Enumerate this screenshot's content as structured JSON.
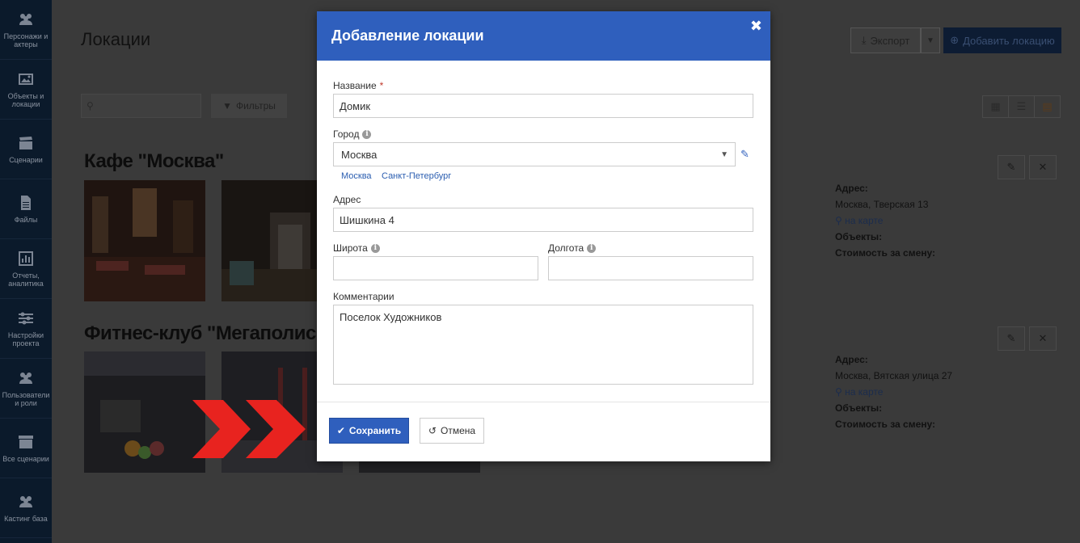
{
  "sidebar": {
    "items": [
      {
        "label": "Персонажи и актеры",
        "icon": "people-icon"
      },
      {
        "label": "Объекты и локации",
        "icon": "image-icon"
      },
      {
        "label": "Сценарии",
        "icon": "clapperboard-icon"
      },
      {
        "label": "Файлы",
        "icon": "file-icon"
      },
      {
        "label": "Отчеты, аналитика",
        "icon": "chart-icon"
      },
      {
        "label": "Настройки проекта",
        "icon": "sliders-icon"
      },
      {
        "label": "Пользователи и роли",
        "icon": "people-icon"
      },
      {
        "label": "Все сценарии",
        "icon": "archive-icon"
      },
      {
        "label": "Кастинг база",
        "icon": "people-icon"
      }
    ]
  },
  "page": {
    "title": "Локации",
    "export_label": "Экспорт",
    "add_label": "Добавить локацию",
    "filters_label": "Фильтры"
  },
  "locations": [
    {
      "name": "Кафе \"Москва\"",
      "address_label": "Адрес:",
      "address": "Москва, Тверская 13",
      "map_label": "на карте",
      "objects_label": "Объекты:",
      "cost_label": "Стоимость за смену:"
    },
    {
      "name": "Фитнес-клуб \"Мегаполис\"",
      "address_label": "Адрес:",
      "address": "Москва, Вятская улица 27",
      "map_label": "на карте",
      "objects_label": "Объекты:",
      "cost_label": "Стоимость за смену:"
    }
  ],
  "modal": {
    "title": "Добавление локации",
    "name_label": "Название",
    "name_value": "Домик",
    "city_label": "Город",
    "city_value": "Москва",
    "city_quick": [
      "Москва",
      "Санкт-Петербург"
    ],
    "address_label": "Адрес",
    "address_value": "Шишкина 4",
    "lat_label": "Широта",
    "lat_value": "",
    "lng_label": "Долгота",
    "lng_value": "",
    "comments_label": "Комментарии",
    "comments_value": "Поселок Художников",
    "save_label": "Сохранить",
    "cancel_label": "Отмена"
  },
  "colors": {
    "modal_header": "#2f5fbd",
    "primary": "#2f5fbd",
    "arrow": "#e8231f"
  }
}
